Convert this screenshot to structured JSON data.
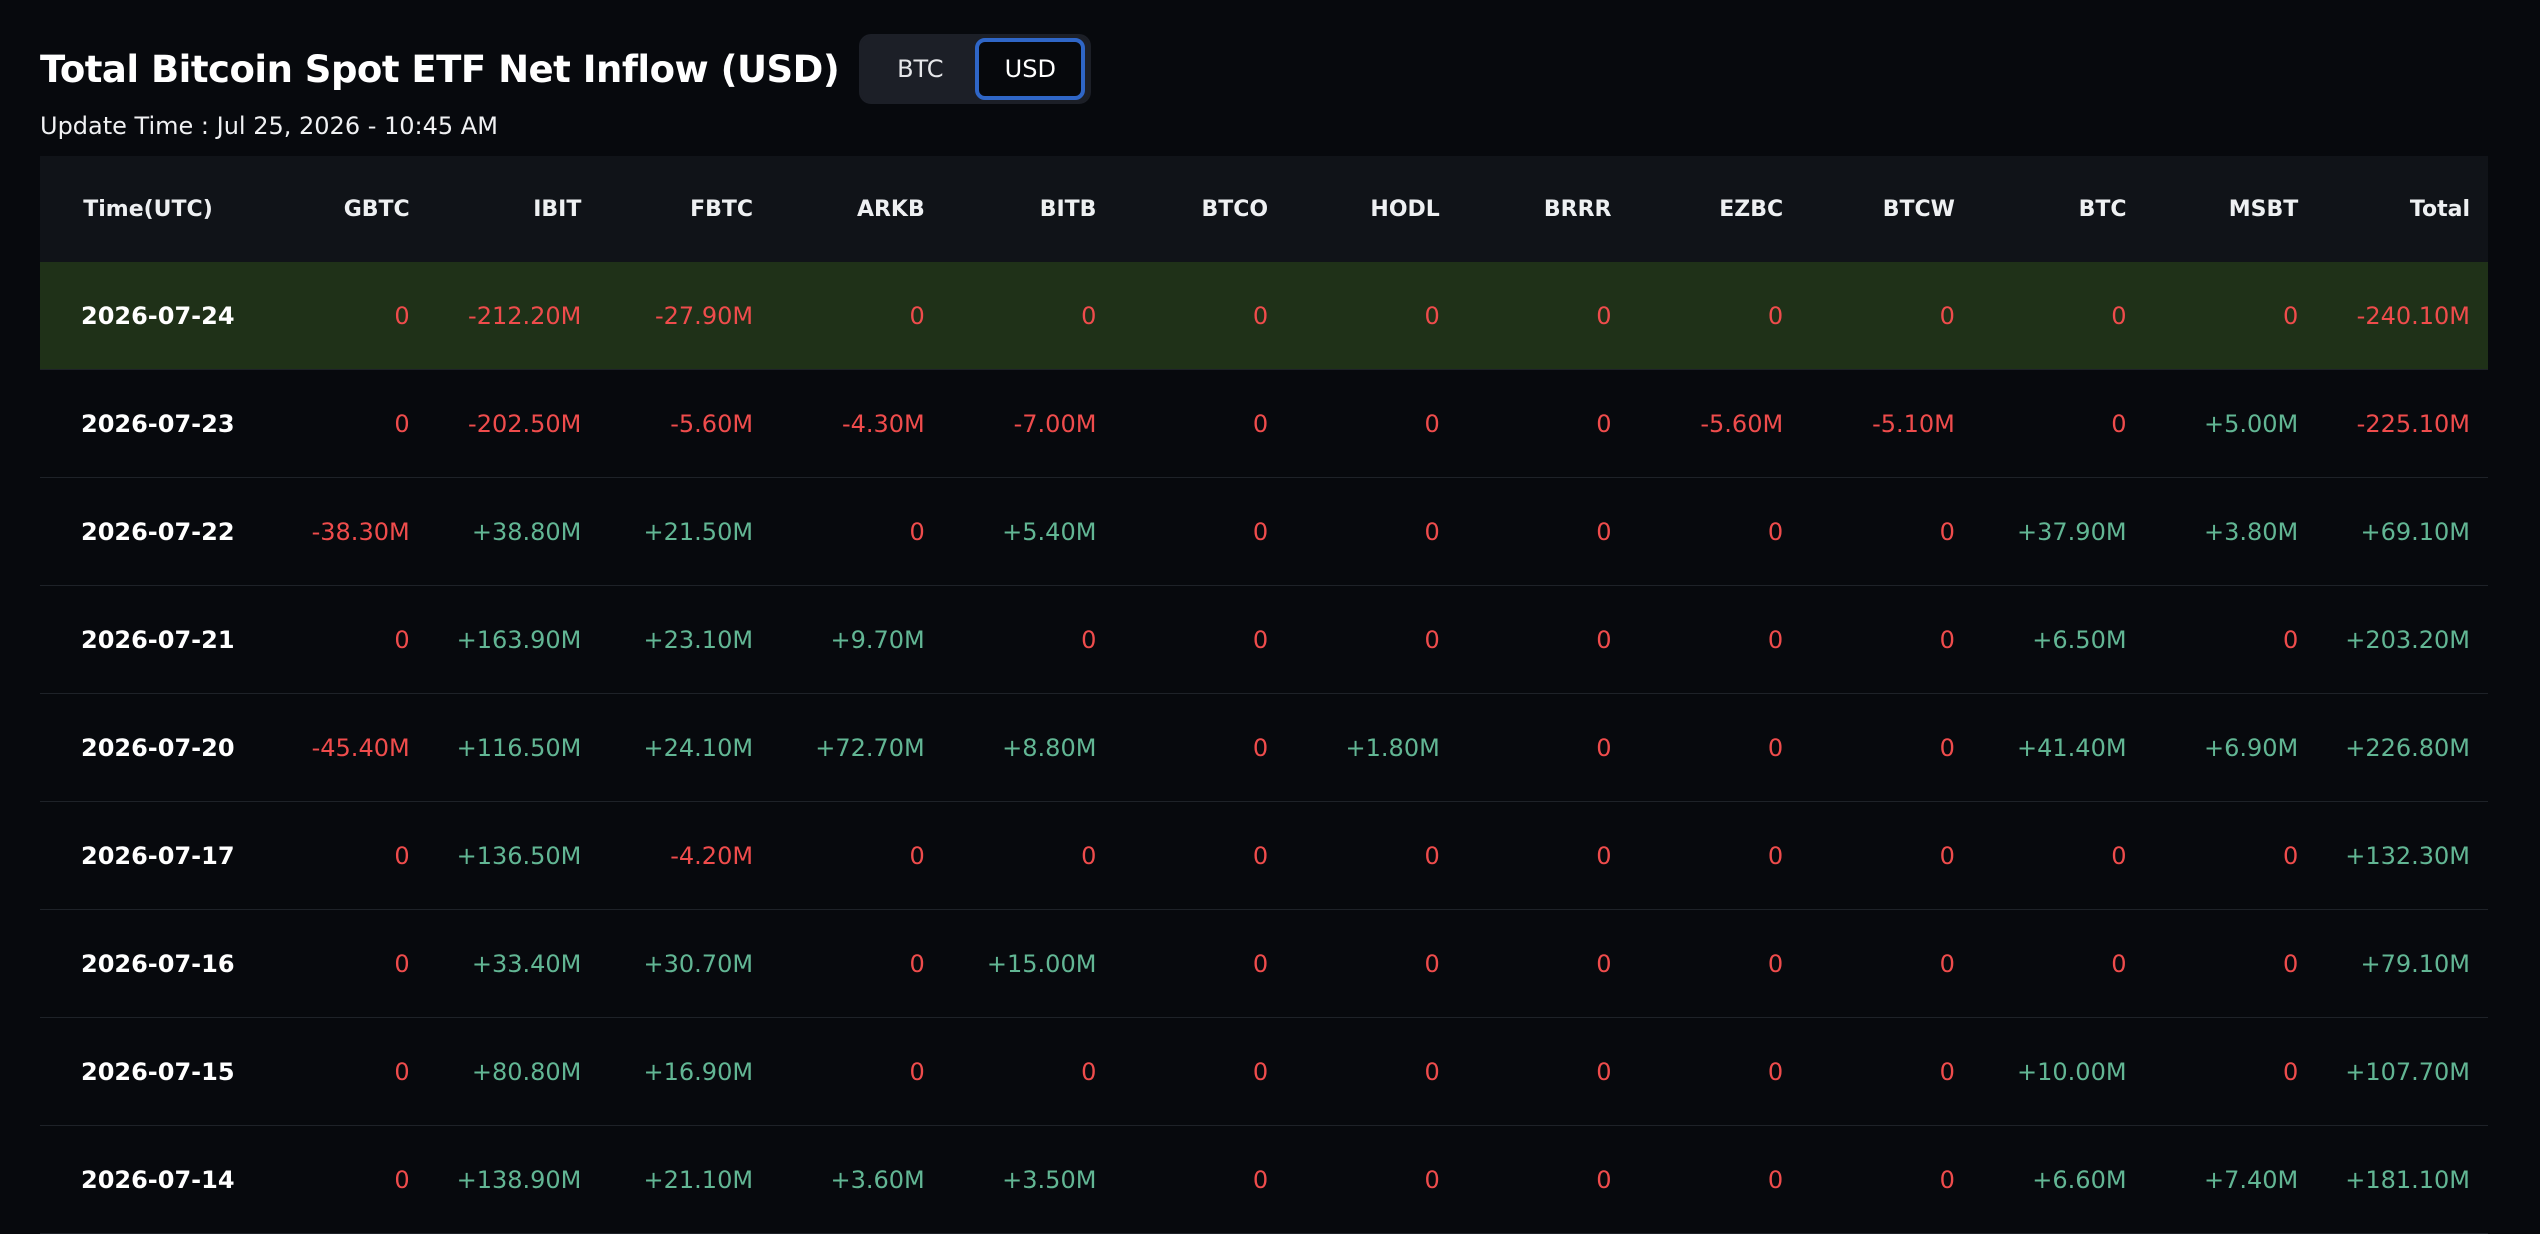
{
  "header": {
    "title": "Total Bitcoin Spot ETF Net Inflow (USD)",
    "update_time": "Update Time : Jul 25, 2026 - 10:45 AM"
  },
  "unit_toggle": {
    "options": [
      "BTC",
      "USD"
    ],
    "selected": "USD"
  },
  "colors": {
    "negative": "#ef4c4c",
    "positive": "#62b694",
    "highlight_row": "#1f3118",
    "toggle_active_border": "#2f66c7"
  },
  "table": {
    "columns": [
      "Time(UTC)",
      "GBTC",
      "IBIT",
      "FBTC",
      "ARKB",
      "BITB",
      "BTCO",
      "HODL",
      "BRRR",
      "EZBC",
      "BTCW",
      "BTC",
      "MSBT",
      "Total"
    ],
    "highlighted_row_index": 0,
    "rows": [
      [
        "2026-07-24",
        "0",
        "-212.20M",
        "-27.90M",
        "0",
        "0",
        "0",
        "0",
        "0",
        "0",
        "0",
        "0",
        "0",
        "-240.10M"
      ],
      [
        "2026-07-23",
        "0",
        "-202.50M",
        "-5.60M",
        "-4.30M",
        "-7.00M",
        "0",
        "0",
        "0",
        "-5.60M",
        "-5.10M",
        "0",
        "+5.00M",
        "-225.10M"
      ],
      [
        "2026-07-22",
        "-38.30M",
        "+38.80M",
        "+21.50M",
        "0",
        "+5.40M",
        "0",
        "0",
        "0",
        "0",
        "0",
        "+37.90M",
        "+3.80M",
        "+69.10M"
      ],
      [
        "2026-07-21",
        "0",
        "+163.90M",
        "+23.10M",
        "+9.70M",
        "0",
        "0",
        "0",
        "0",
        "0",
        "0",
        "+6.50M",
        "0",
        "+203.20M"
      ],
      [
        "2026-07-20",
        "-45.40M",
        "+116.50M",
        "+24.10M",
        "+72.70M",
        "+8.80M",
        "0",
        "+1.80M",
        "0",
        "0",
        "0",
        "+41.40M",
        "+6.90M",
        "+226.80M"
      ],
      [
        "2026-07-17",
        "0",
        "+136.50M",
        "-4.20M",
        "0",
        "0",
        "0",
        "0",
        "0",
        "0",
        "0",
        "0",
        "0",
        "+132.30M"
      ],
      [
        "2026-07-16",
        "0",
        "+33.40M",
        "+30.70M",
        "0",
        "+15.00M",
        "0",
        "0",
        "0",
        "0",
        "0",
        "0",
        "0",
        "+79.10M"
      ],
      [
        "2026-07-15",
        "0",
        "+80.80M",
        "+16.90M",
        "0",
        "0",
        "0",
        "0",
        "0",
        "0",
        "0",
        "+10.00M",
        "0",
        "+107.70M"
      ],
      [
        "2026-07-14",
        "0",
        "+138.90M",
        "+21.10M",
        "+3.60M",
        "+3.50M",
        "0",
        "0",
        "0",
        "0",
        "0",
        "+6.60M",
        "+7.40M",
        "+181.10M"
      ]
    ]
  }
}
